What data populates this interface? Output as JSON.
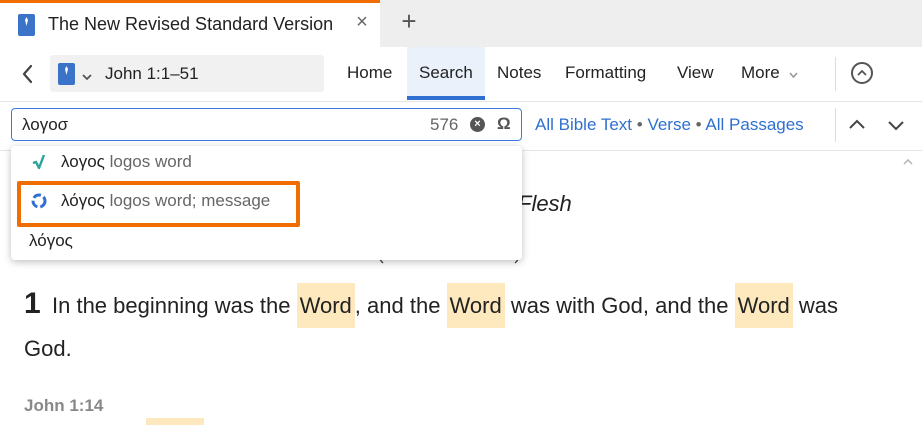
{
  "tab": {
    "title": "The New Revised Standard Version",
    "close_glyph": "×",
    "new_tab_glyph": "+"
  },
  "toolbar": {
    "reference": "John 1:1–51",
    "menus": [
      "Home",
      "Search",
      "Notes",
      "Formatting",
      "View",
      "More"
    ],
    "active_menu": "Search"
  },
  "search": {
    "query": "λογοσ",
    "count": "576",
    "clear_glyph": "×",
    "omega_glyph": "Ω",
    "scope": [
      "All Bible Text",
      "Verse",
      "All Passages"
    ],
    "scope_separator": "•"
  },
  "suggestions": [
    {
      "term": "λογος",
      "gloss": "logos word",
      "icon": "root-lemma-icon"
    },
    {
      "term": "λόγος",
      "gloss": "logos word; message",
      "icon": "lemma-icon",
      "highlighted": true
    },
    {
      "term": "λόγος",
      "gloss": ""
    }
  ],
  "reading": {
    "heading_tail": "Flesh",
    "verse_number": "1",
    "verse_parts": [
      "In the beginning was the ",
      "Word",
      ", and the ",
      "Word",
      " was with God, and the ",
      "Word",
      " was"
    ],
    "verse_line2": "God.",
    "next_ref": "John 1:14"
  },
  "colors": {
    "accent": "#2f6fcf",
    "highlight_box": "#f06e00",
    "hit_highlight": "#fde9bd",
    "tab_top": "#f06e00"
  }
}
